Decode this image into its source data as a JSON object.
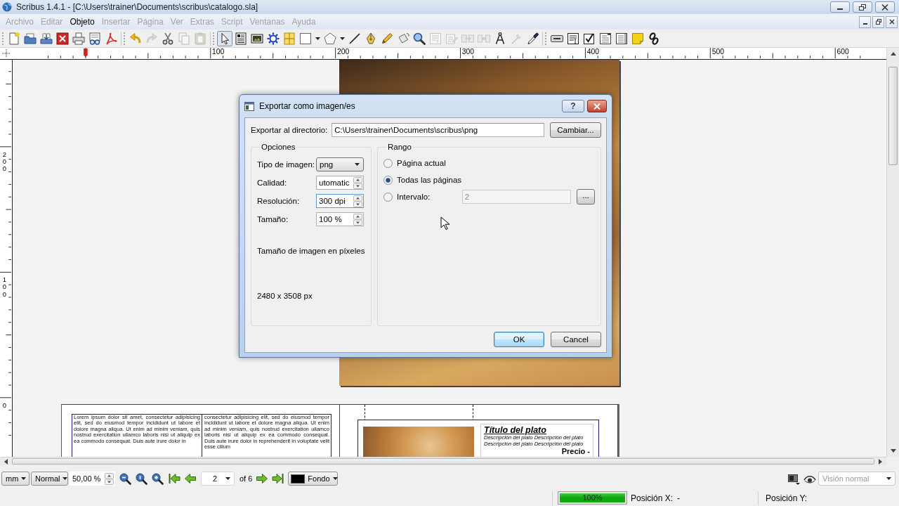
{
  "window": {
    "title": "Scribus 1.4.1 - [C:\\Users\\trainer\\Documents\\scribus\\catalogo.sla]"
  },
  "menu": [
    {
      "label": "Archivo",
      "disabled": true
    },
    {
      "label": "Editar",
      "disabled": true
    },
    {
      "label": "Objeto",
      "disabled": false
    },
    {
      "label": "Insertar",
      "disabled": true
    },
    {
      "label": "Página",
      "disabled": true
    },
    {
      "label": "Ver",
      "disabled": true
    },
    {
      "label": "Extras",
      "disabled": true
    },
    {
      "label": "Script",
      "disabled": true
    },
    {
      "label": "Ventanas",
      "disabled": true
    },
    {
      "label": "Ayuda",
      "disabled": true
    }
  ],
  "toolbar": {
    "groups": [
      [
        {
          "kind": "new",
          "disabled": false
        },
        {
          "kind": "open",
          "disabled": false
        },
        {
          "kind": "save",
          "disabled": false
        },
        {
          "kind": "close",
          "disabled": false
        },
        {
          "kind": "print",
          "disabled": false
        },
        {
          "kind": "preflight",
          "disabled": false
        },
        {
          "kind": "pdf",
          "disabled": false
        }
      ],
      [
        {
          "kind": "undo",
          "disabled": false
        },
        {
          "kind": "redo",
          "disabled": true
        },
        {
          "kind": "cut",
          "disabled": false
        },
        {
          "kind": "copy",
          "disabled": true
        },
        {
          "kind": "paste",
          "disabled": true
        }
      ],
      [
        {
          "kind": "select",
          "disabled": false,
          "selected": true
        },
        {
          "kind": "textframe",
          "disabled": false,
          "selected": false
        },
        {
          "kind": "imageframe",
          "disabled": false,
          "selected": false
        },
        {
          "kind": "render",
          "disabled": false,
          "selected": false
        },
        {
          "kind": "table",
          "disabled": false,
          "selected": false
        },
        {
          "kind": "shape",
          "disabled": false,
          "selected": false
        },
        {
          "kind": "polygon",
          "disabled": false,
          "selected": false
        },
        {
          "kind": "line",
          "disabled": false,
          "selected": false
        },
        {
          "kind": "bezier",
          "disabled": false,
          "selected": false
        },
        {
          "kind": "freehand",
          "disabled": false,
          "selected": false
        },
        {
          "kind": "rotate",
          "disabled": false,
          "selected": false
        },
        {
          "kind": "zoom",
          "disabled": false,
          "selected": false
        },
        {
          "kind": "editcontent",
          "disabled": true,
          "selected": false
        },
        {
          "kind": "edittext",
          "disabled": true,
          "selected": false
        },
        {
          "kind": "link",
          "disabled": true,
          "selected": false
        },
        {
          "kind": "unlink",
          "disabled": true,
          "selected": false
        },
        {
          "kind": "measure",
          "disabled": false,
          "selected": false
        },
        {
          "kind": "copyprops",
          "disabled": true,
          "selected": false
        },
        {
          "kind": "eyedropper",
          "disabled": false,
          "selected": false
        }
      ],
      [
        {
          "kind": "pushbutton",
          "disabled": false
        },
        {
          "kind": "textfield",
          "disabled": false
        },
        {
          "kind": "checkbox",
          "disabled": false
        },
        {
          "kind": "combobox",
          "disabled": false
        },
        {
          "kind": "listbox",
          "disabled": false
        },
        {
          "kind": "note",
          "disabled": false
        },
        {
          "kind": "linkannot",
          "disabled": false
        }
      ]
    ]
  },
  "ruler": {
    "horizontal": [
      "100",
      "200",
      "300",
      "400",
      "500",
      "600"
    ],
    "vertical": [
      "200",
      "100",
      "0"
    ]
  },
  "canvas": {
    "text_columns": [
      "Lorem ipsum dolor sit amet, consectetur adipisicing elit, sed do eiusmod tempor incididunt ut labore et dolore magna aliqua. Ut enim ad minim veniam, quis nostrud exercitation ullamco laboris nisi ut aliquip ex ea commodo consequat. Duis aute irure dolor in",
      "consectetur adipisicing elit, sed do eiusmod tempor incididunt ut labore et dolore magna aliqua. Ut enim ad minim veniam, quis nostrud exercitation ullamco laboris nisi ut aliquip ex ea commodo consequat. Duis aute irure dolor in reprehenderit in voluptate velit esse cillum"
    ],
    "menu_card": {
      "title": "Título del plato",
      "descriptions": [
        "Descripción del plato Descripción del plato",
        "Descripción del plato Descripción del plato"
      ],
      "price": "Precio -"
    }
  },
  "dialog": {
    "title": "Exportar como imagen/es",
    "help_button": "?",
    "directory": {
      "label": "Exportar al directorio:",
      "value": "C:\\Users\\trainer\\Documents\\scribus\\png"
    },
    "change_button": "Cambiar...",
    "options": {
      "title": "Opciones",
      "fields": [
        {
          "label": "Tipo de imagen:",
          "kind": "combo",
          "value": "png",
          "focused": false
        },
        {
          "label": "Calidad:",
          "kind": "spin",
          "value": "utomatic",
          "focused": false
        },
        {
          "label": "Resolución:",
          "kind": "spin",
          "value": "300 dpi",
          "focused": true
        },
        {
          "label": "Tamaño:",
          "kind": "spin",
          "value": "100 %",
          "focused": false
        }
      ],
      "size_label": "Tamaño de imagen en píxeles",
      "size_value": "2480 x 3508 px"
    },
    "range": {
      "title": "Rango",
      "choices": [
        {
          "label": "Página actual",
          "selected": false
        },
        {
          "label": "Todas las páginas",
          "selected": true
        },
        {
          "label": "Intervalo:",
          "selected": false
        }
      ],
      "interval": {
        "value": "2",
        "disabled": true
      },
      "more_button": "..."
    },
    "buttons": [
      {
        "label": "OK",
        "default": true
      },
      {
        "label": "Cancel",
        "default": false
      }
    ]
  },
  "view_bar": {
    "unit": "mm",
    "quality": "Normal",
    "zoom": "50,00 %",
    "page": "2",
    "page_count": "of 6",
    "layer": {
      "name": "Fondo",
      "color": "#000000"
    },
    "view_mode": {
      "value": "Visión normal",
      "disabled": true
    }
  },
  "status_bar": {
    "progress": {
      "level": 1,
      "label": "100%"
    },
    "position_x": {
      "label": "Posición X:",
      "value": "-"
    },
    "position_y": {
      "label": "Posición Y:"
    }
  }
}
